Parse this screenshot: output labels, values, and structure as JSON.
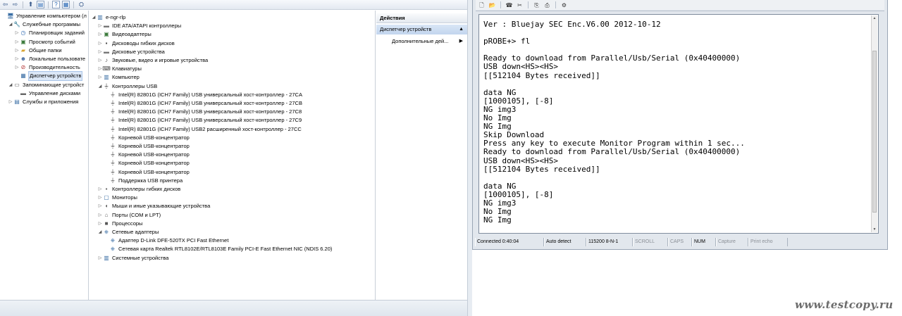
{
  "left_tree": [
    {
      "label": "Управление компьютером (л",
      "exp": "",
      "icon": "computer-management-icon",
      "indent": 0
    },
    {
      "label": "Служебные программы",
      "exp": "◢",
      "icon": "tools-icon",
      "indent": 1
    },
    {
      "label": "Планировщик заданий",
      "exp": "▷",
      "icon": "clock-icon",
      "indent": 2
    },
    {
      "label": "Просмотр событий",
      "exp": "▷",
      "icon": "event-viewer-icon",
      "indent": 2
    },
    {
      "label": "Общие папки",
      "exp": "▷",
      "icon": "shared-folder-icon",
      "indent": 2
    },
    {
      "label": "Локальные пользовате",
      "exp": "▷",
      "icon": "users-icon",
      "indent": 2
    },
    {
      "label": "Производительность",
      "exp": "▷",
      "icon": "performance-icon",
      "indent": 2
    },
    {
      "label": "Диспетчер устройств",
      "exp": "",
      "icon": "device-manager-icon",
      "indent": 2,
      "selected": true
    },
    {
      "label": "Запоминающие устройст",
      "exp": "◢",
      "icon": "storage-icon",
      "indent": 1
    },
    {
      "label": "Управление дисками",
      "exp": "",
      "icon": "disk-management-icon",
      "indent": 2
    },
    {
      "label": "Службы и приложения",
      "exp": "▷",
      "icon": "services-icon",
      "indent": 1
    }
  ],
  "device_tree": [
    {
      "label": "e-ngr-rlp",
      "exp": "◢",
      "icon": "computer-icon",
      "indent": 0
    },
    {
      "label": "IDE ATA/ATAPI контроллеры",
      "exp": "▷",
      "icon": "ide-icon",
      "indent": 1
    },
    {
      "label": "Видеоадаптеры",
      "exp": "▷",
      "icon": "display-adapter-icon",
      "indent": 1
    },
    {
      "label": "Дисководы гибких дисков",
      "exp": "▷",
      "icon": "floppy-icon",
      "indent": 1
    },
    {
      "label": "Дисковые устройства",
      "exp": "▷",
      "icon": "disk-drive-icon",
      "indent": 1
    },
    {
      "label": "Звуковые, видео и игровые устройства",
      "exp": "▷",
      "icon": "sound-icon",
      "indent": 1
    },
    {
      "label": "Клавиатуры",
      "exp": "▷",
      "icon": "keyboard-icon",
      "indent": 1
    },
    {
      "label": "Компьютер",
      "exp": "▷",
      "icon": "computer-icon",
      "indent": 1
    },
    {
      "label": "Контроллеры USB",
      "exp": "◢",
      "icon": "usb-icon",
      "indent": 1
    },
    {
      "label": "Intel(R) 82801G (ICH7 Family) USB универсальный хост-контроллер  - 27CA",
      "exp": "",
      "icon": "usb-icon",
      "indent": 2
    },
    {
      "label": "Intel(R) 82801G (ICH7 Family) USB универсальный хост-контроллер  - 27CB",
      "exp": "",
      "icon": "usb-icon",
      "indent": 2
    },
    {
      "label": "Intel(R) 82801G (ICH7 Family) USB универсальный хост-контроллер  - 27C8",
      "exp": "",
      "icon": "usb-icon",
      "indent": 2
    },
    {
      "label": "Intel(R) 82801G (ICH7 Family) USB универсальный хост-контроллер  - 27C9",
      "exp": "",
      "icon": "usb-icon",
      "indent": 2
    },
    {
      "label": "Intel(R) 82801G (ICH7 Family) USB2 расширенный хост-контроллер  - 27CC",
      "exp": "",
      "icon": "usb-icon",
      "indent": 2
    },
    {
      "label": "Корневой USB-концентратор",
      "exp": "",
      "icon": "usb-icon",
      "indent": 2
    },
    {
      "label": "Корневой USB-концентратор",
      "exp": "",
      "icon": "usb-icon",
      "indent": 2
    },
    {
      "label": "Корневой USB-концентратор",
      "exp": "",
      "icon": "usb-icon",
      "indent": 2
    },
    {
      "label": "Корневой USB-концентратор",
      "exp": "",
      "icon": "usb-icon",
      "indent": 2
    },
    {
      "label": "Корневой USB-концентратор",
      "exp": "",
      "icon": "usb-icon",
      "indent": 2
    },
    {
      "label": "Поддержка USB принтера",
      "exp": "",
      "icon": "usb-icon",
      "indent": 2
    },
    {
      "label": "Контроллеры гибких дисков",
      "exp": "▷",
      "icon": "floppy-controller-icon",
      "indent": 1
    },
    {
      "label": "Мониторы",
      "exp": "▷",
      "icon": "monitor-icon",
      "indent": 1
    },
    {
      "label": "Мыши и иные указывающие устройства",
      "exp": "▷",
      "icon": "mouse-icon",
      "indent": 1
    },
    {
      "label": "Порты (COM и LPT)",
      "exp": "▷",
      "icon": "port-icon",
      "indent": 1
    },
    {
      "label": "Процессоры",
      "exp": "▷",
      "icon": "processor-icon",
      "indent": 1
    },
    {
      "label": "Сетевые адаптеры",
      "exp": "◢",
      "icon": "network-icon",
      "indent": 1
    },
    {
      "label": "Адаптер D-Link DFE-520TX PCI Fast Ethernet",
      "exp": "",
      "icon": "network-icon",
      "indent": 2
    },
    {
      "label": "Сетевая карта Realtek RTL8102E/RTL8103E Family PCI-E Fast Ethernet NIC (NDIS 6.20)",
      "exp": "",
      "icon": "network-icon",
      "indent": 2
    },
    {
      "label": "Системные устройства",
      "exp": "▷",
      "icon": "system-devices-icon",
      "indent": 1
    }
  ],
  "actions": {
    "header": "Действия",
    "section": "Диспетчер устройств",
    "more": "Дополнительные дей..."
  },
  "terminal": {
    "lines": [
      "Ver : Bluejay SEC Enc.V6.00 2012-10-12",
      "",
      "pROBE+> fl",
      "",
      "Ready to download from Parallel/Usb/Serial (0x40400000)",
      "USB down<HS><HS>",
      "[[512104 Bytes received]]",
      "",
      "data NG",
      "[1000105], [-8]",
      "NG img3",
      "No Img",
      "NG Img",
      "Skip Download",
      "Press any key to execute Monitor Program within 1 sec...",
      "Ready to download from Parallel/Usb/Serial (0x40400000)",
      "USB down<HS><HS>",
      "[[512104 Bytes received]]",
      "",
      "data NG",
      "[1000105], [-8]",
      "NG img3",
      "No Img",
      "NG Img"
    ],
    "status": [
      {
        "text": "Connected 0:40:04",
        "state": "on"
      },
      {
        "text": "Auto detect",
        "state": "on"
      },
      {
        "text": "115200 8-N-1",
        "state": "on"
      },
      {
        "text": "SCROLL",
        "state": "off"
      },
      {
        "text": "CAPS",
        "state": "off"
      },
      {
        "text": "NUM",
        "state": "on"
      },
      {
        "text": "Capture",
        "state": "off"
      },
      {
        "text": "Print echo",
        "state": "off"
      }
    ]
  },
  "watermark": "www.testcopy.ru"
}
